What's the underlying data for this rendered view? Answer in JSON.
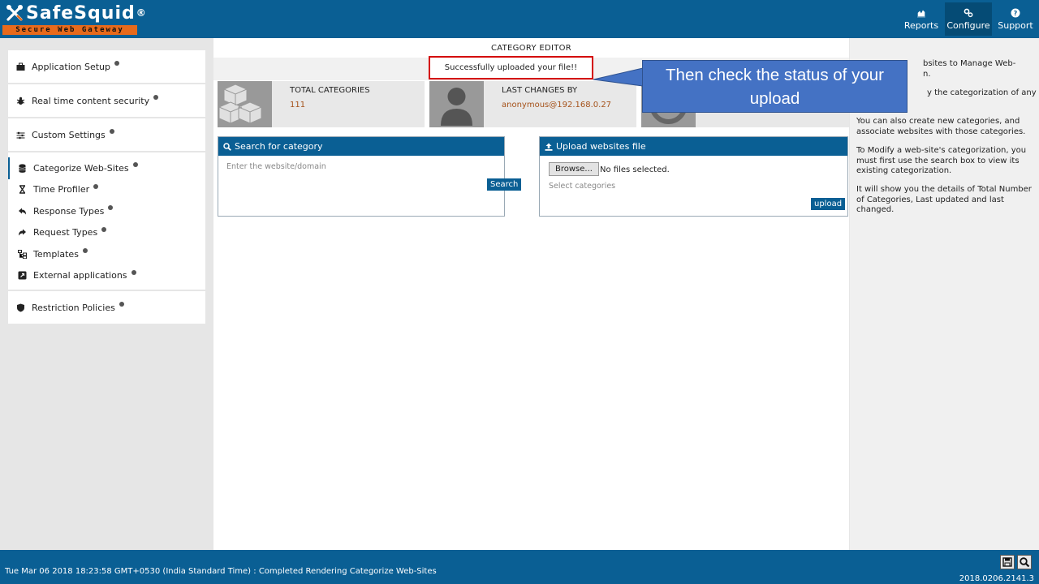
{
  "header": {
    "logo_name": "SafeSquid",
    "logo_reg": "®",
    "logo_tagline": "Secure Web Gateway",
    "nav": [
      {
        "label": "Reports",
        "icon": "chart-icon"
      },
      {
        "label": "Configure",
        "icon": "cogs-icon"
      },
      {
        "label": "Support",
        "icon": "question-icon"
      }
    ]
  },
  "sidebar": {
    "groups_top": [
      {
        "label": "Application Setup",
        "icon": "briefcase-icon"
      },
      {
        "label": "Real time content security",
        "icon": "bug-icon"
      },
      {
        "label": "Custom Settings",
        "icon": "sliders-icon"
      }
    ],
    "sub_items": [
      {
        "label": "Categorize Web-Sites",
        "icon": "database-icon"
      },
      {
        "label": "Time Profiler",
        "icon": "hourglass-icon"
      },
      {
        "label": "Response Types",
        "icon": "reply-icon"
      },
      {
        "label": "Request Types",
        "icon": "share-icon"
      },
      {
        "label": "Templates",
        "icon": "sitemap-icon"
      },
      {
        "label": "External applications",
        "icon": "external-link-icon"
      }
    ],
    "groups_bottom": [
      {
        "label": "Restriction Policies",
        "icon": "shield-icon"
      }
    ]
  },
  "main": {
    "title": "CATEGORY EDITOR",
    "message": "Successfully uploaded your file!!",
    "stats": [
      {
        "label": "TOTAL CATEGORIES",
        "value": "111"
      },
      {
        "label": "LAST CHANGES BY",
        "value": "anonymous@192.168.0.27"
      }
    ],
    "search_panel": {
      "title": "Search for category",
      "placeholder": "Enter the website/domain",
      "button": "Search"
    },
    "upload_panel": {
      "title": "Upload websites file",
      "browse": "Browse...",
      "file_status": "No files selected.",
      "categories_placeholder": "Select categories",
      "button": "upload"
    }
  },
  "help": {
    "p1a": "bsites to Manage Web-",
    "p1b": "n.",
    "p2": "y the categorization of any",
    "p3": "You can also create new categories, and associate websites with those categories.",
    "p4": "To Modify a web-site's categorization, you must first use the search box to view its existing categorization.",
    "p5": "It will show you the details of Total Number of Categories, Last updated and last changed."
  },
  "callout": {
    "text": "Then check the status of your upload"
  },
  "footer": {
    "status": "Tue Mar 06 2018 18:23:58 GMT+0530 (India Standard Time) : Completed Rendering Categorize Web-Sites",
    "version": "2018.0206.2141.3"
  },
  "colors": {
    "brand_blue": "#0a5f94",
    "accent_orange": "#e76a1c",
    "callout_blue": "#4472c4",
    "highlight_red": "#d40000",
    "value_brown": "#a5521a"
  }
}
